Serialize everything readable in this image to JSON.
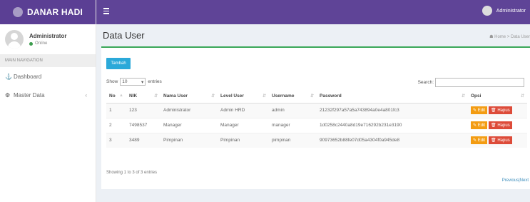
{
  "brand": {
    "name": "DANAR HADI"
  },
  "topbar": {
    "user": "Administrator"
  },
  "sidebar": {
    "user_name": "Administrator",
    "status": "Online",
    "nav_header": "MAIN NAVIGATION",
    "items": [
      {
        "label": "Dashboard",
        "icon": "dashboard-icon"
      },
      {
        "label": "Master Data",
        "icon": "gear-icon"
      }
    ]
  },
  "page": {
    "title": "Data User",
    "breadcrumb_home": "Home",
    "breadcrumb_current": "Data User"
  },
  "toolbar": {
    "add_label": "Tambah",
    "show_label": "Show",
    "entries_value": "10",
    "entries_label": "entries",
    "search_label": "Search:"
  },
  "table": {
    "headers": [
      "No",
      "NIK",
      "Nama User",
      "Level User",
      "Username",
      "Password",
      "Opsi"
    ],
    "rows": [
      [
        "1",
        "123",
        "Administrator",
        "Admin HRD",
        "admin",
        "21232f297a57a5a743894a0e4a801fc3"
      ],
      [
        "2",
        "7498537",
        "Manager",
        "Manager",
        "manager",
        "1d0258c2440a8d19e716292b231e3190"
      ],
      [
        "3",
        "3489",
        "Pimpinan",
        "Pimpinan",
        "pimpinan",
        "90973652b88fe07d05a4304f0a945de8"
      ]
    ],
    "edit_label": "Edit",
    "delete_label": "Hapus"
  },
  "footer": {
    "info": "Showing 1 to 3 of 3 entries",
    "prev": "Previous",
    "next": "Next"
  },
  "colors": {
    "topbar": "#5f4497",
    "brand": "#5b3f94",
    "accent_green": "#3aa758",
    "add_button": "#2ba9d9",
    "edit_button": "#f39c12",
    "delete_button": "#dd4b39"
  }
}
